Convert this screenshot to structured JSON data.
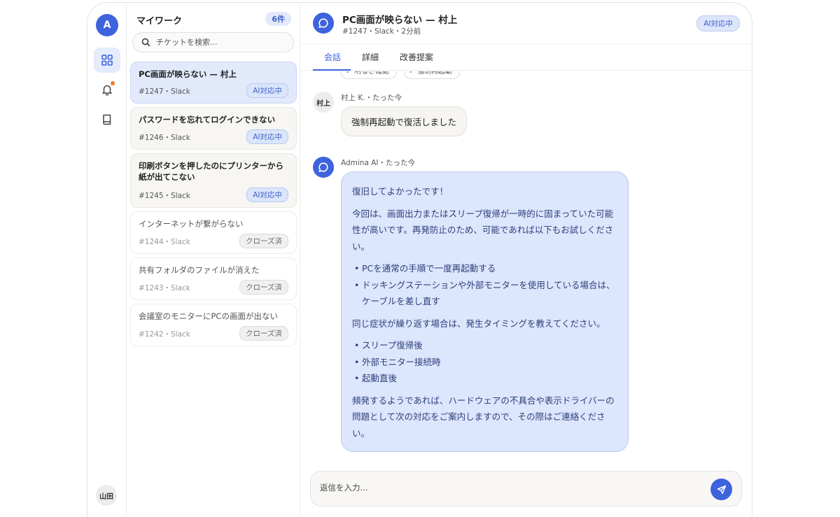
{
  "rail": {
    "user_initial": "A",
    "nav_icons": [
      "grid-icon",
      "bell-icon",
      "book-icon"
    ],
    "profile_name": "山田",
    "accent_color": "#3d63dd",
    "notification_color": "#f07a2b"
  },
  "list": {
    "title": "マイワーク",
    "count": "6件",
    "search_placeholder": "チケットを検索...",
    "tickets": [
      {
        "title": "PC画面が映らない — 村上",
        "meta": "#1247・Slack",
        "status": "AI対応中",
        "state": "active"
      },
      {
        "title": "パスワードを忘れてログインできない",
        "meta": "#1246・Slack",
        "status": "AI対応中",
        "state": "open"
      },
      {
        "title": "印刷ボタンを押したのにプリンターから紙が出てこない",
        "meta": "#1245・Slack",
        "status": "AI対応中",
        "state": "open"
      },
      {
        "title": "インターネットが繋がらない",
        "meta": "#1244・Slack",
        "status": "クローズ済",
        "state": "closed"
      },
      {
        "title": "共有フォルダのファイルが消えた",
        "meta": "#1243・Slack",
        "status": "クローズ済",
        "state": "closed"
      },
      {
        "title": "会議室のモニターにPCの画面が出ない",
        "meta": "#1242・Slack",
        "status": "クローズ済",
        "state": "closed"
      }
    ]
  },
  "header": {
    "title": "PC画面が映らない — 村上",
    "meta": "#1247・Slack・2分前",
    "status": "AI対応中"
  },
  "tabs": [
    "会話",
    "詳細",
    "改善提案"
  ],
  "conversation": {
    "chips": [
      "明るさ確認",
      "強制再起動"
    ],
    "user_message": {
      "avatar": "村上",
      "meta": "村上 K.・たった今",
      "text": "強制再起動で復活しました"
    },
    "ai_message": {
      "meta": "Admina AI・たった今",
      "p1": "復旧してよかったです！",
      "p2": "今回は、画面出力またはスリープ復帰が一時的に固まっていた可能性が高いです。再発防止のため、可能であれば以下もお試しください。",
      "list1": [
        "PCを通常の手順で一度再起動する",
        "ドッキングステーションや外部モニターを使用している場合は、ケーブルを差し直す"
      ],
      "p3": "同じ症状が繰り返す場合は、発生タイミングを教えてください。",
      "list2": [
        "スリープ復帰後",
        "外部モニター接続時",
        "起動直後"
      ],
      "p4": "頻発するようであれば、ハードウェアの不具合や表示ドライバーの問題として次の対応をご案内しますので、その際はご連絡ください。"
    }
  },
  "composer": {
    "placeholder": "返信を入力..."
  }
}
